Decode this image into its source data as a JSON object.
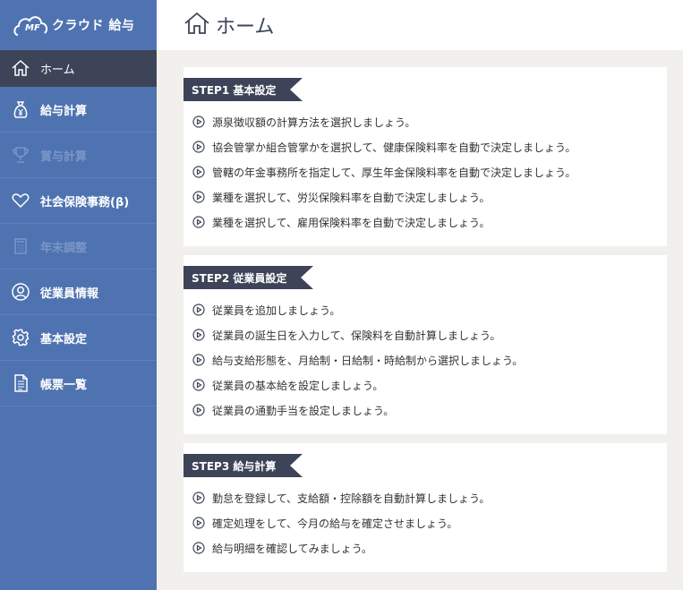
{
  "app": {
    "logo_mf": "MF",
    "logo_text": "クラウド 給与"
  },
  "sidebar": {
    "items": [
      {
        "label": "ホーム",
        "icon": "home-icon",
        "state": "active"
      },
      {
        "label": "給与計算",
        "icon": "money-bag-icon",
        "state": "normal"
      },
      {
        "label": "賞与計算",
        "icon": "trophy-icon",
        "state": "disabled"
      },
      {
        "label": "社会保険事務(β)",
        "icon": "heart-icon",
        "state": "normal"
      },
      {
        "label": "年末調整",
        "icon": "calculator-icon",
        "state": "disabled"
      },
      {
        "label": "従業員情報",
        "icon": "person-icon",
        "state": "normal"
      },
      {
        "label": "基本設定",
        "icon": "gear-icon",
        "state": "normal"
      },
      {
        "label": "帳票一覧",
        "icon": "document-icon",
        "state": "normal"
      }
    ]
  },
  "header": {
    "title": "ホーム",
    "icon": "home-icon"
  },
  "steps": [
    {
      "title": "STEP1 基本設定",
      "items": [
        "源泉徴収額の計算方法を選択しましょう。",
        "協会管掌か組合管掌かを選択して、健康保険料率を自動で決定しましょう。",
        "管轄の年金事務所を指定して、厚生年金保険料率を自動で決定しましょう。",
        "業種を選択して、労災保険料率を自動で決定しましょう。",
        "業種を選択して、雇用保険料率を自動で決定しましょう。"
      ]
    },
    {
      "title": "STEP2 従業員設定",
      "items": [
        "従業員を追加しましょう。",
        "従業員の誕生日を入力して、保険料を自動計算しましょう。",
        "給与支給形態を、月給制・日給制・時給制から選択しましょう。",
        "従業員の基本給を設定しましょう。",
        "従業員の通勤手当を設定しましょう。"
      ]
    },
    {
      "title": "STEP3 給与計算",
      "items": [
        "勤怠を登録して、支給額・控除額を自動計算しましょう。",
        "確定処理をして、今月の給与を確定させましょう。",
        "給与明細を確認してみましょう。"
      ]
    }
  ],
  "colors": {
    "sidebar": "#4f73b1",
    "active": "#3d4458",
    "background": "#f1f0ec"
  }
}
